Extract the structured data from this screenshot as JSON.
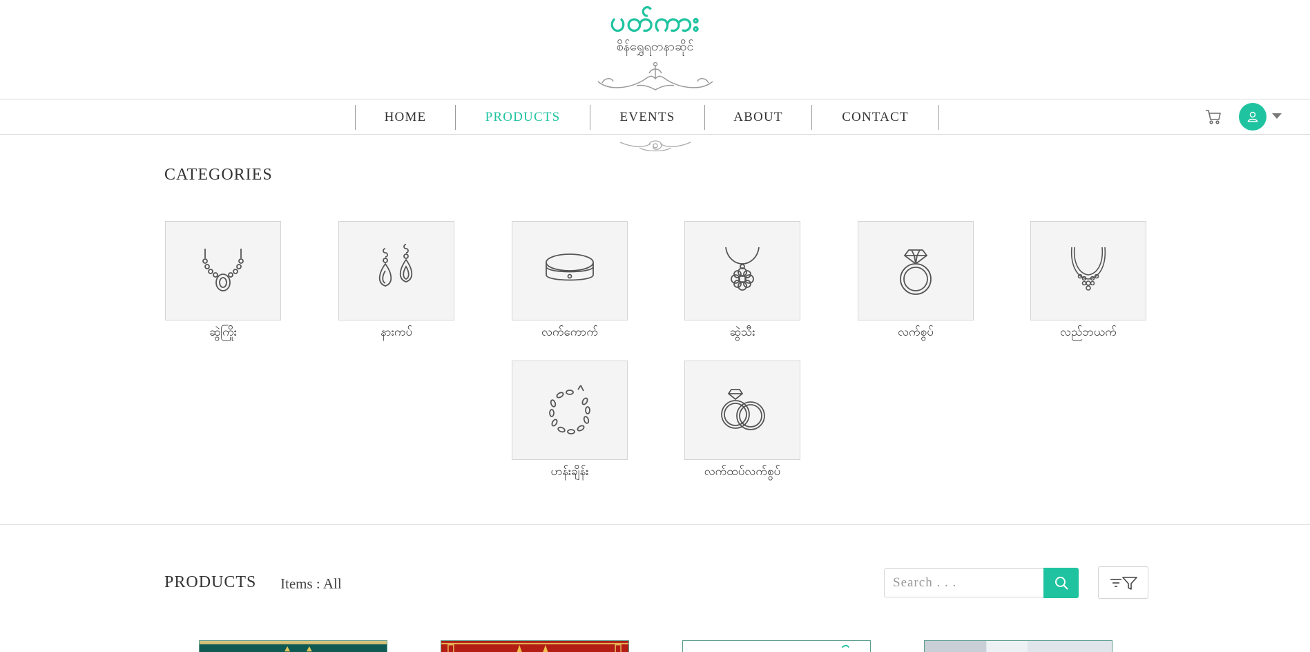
{
  "brand": {
    "title": "ပတ်ကား",
    "subtitle": "စိန်ရွှေရတနာဆိုင်"
  },
  "nav": {
    "items": [
      {
        "label": "HOME"
      },
      {
        "label": "PRODUCTS"
      },
      {
        "label": "EVENTS"
      },
      {
        "label": "ABOUT"
      },
      {
        "label": "CONTACT"
      }
    ],
    "active": "PRODUCTS"
  },
  "categories": {
    "title": "CATEGORIES",
    "items": [
      {
        "label": "ဆွဲကြိုး",
        "icon": "necklace-icon"
      },
      {
        "label": "နားကပ်",
        "icon": "earrings-icon"
      },
      {
        "label": "လက်ကောက်",
        "icon": "bangle-icon"
      },
      {
        "label": "ဆွဲသီး",
        "icon": "pendant-icon"
      },
      {
        "label": "လက်စွပ်",
        "icon": "ring-icon"
      },
      {
        "label": "လည်ဘယက်",
        "icon": "choker-icon"
      },
      {
        "label": "ဟန်းချိန်း",
        "icon": "chain-bracelet-icon"
      },
      {
        "label": "လက်ထပ်လက်စွပ်",
        "icon": "wedding-rings-icon"
      }
    ]
  },
  "products": {
    "title": "PRODUCTS",
    "items_label": "Items : All",
    "search_placeholder": "Search . . .",
    "search_value": ""
  },
  "colors": {
    "accent": "#20c3a0",
    "category_bg": "#f4f4f4"
  }
}
